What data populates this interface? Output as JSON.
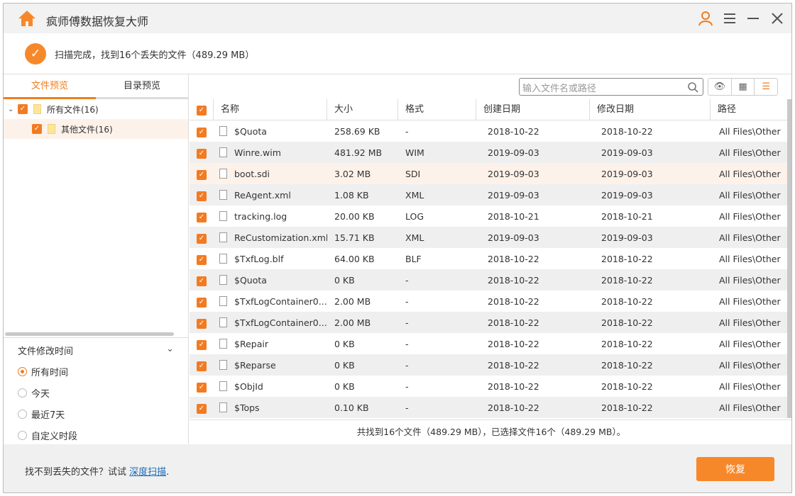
{
  "app": {
    "title": "疯师傅数据恢复大师"
  },
  "header": {
    "status": "扫描完成，找到16个丢失的文件（489.29 MB）"
  },
  "tabs": [
    {
      "label": "文件预览"
    },
    {
      "label": "目录预览"
    }
  ],
  "tree": [
    {
      "label": "所有文件(16)"
    },
    {
      "label": "其他文件(16)"
    }
  ],
  "filter": {
    "title": "文件修改时间",
    "options": [
      "所有时间",
      "今天",
      "最近7天",
      "自定义时段"
    ],
    "selected": "所有时间"
  },
  "search": {
    "placeholder": "输入文件名或路径"
  },
  "columns": [
    "名称",
    "大小",
    "格式",
    "创建日期",
    "修改日期",
    "路径"
  ],
  "rows": [
    [
      "$Quota",
      "258.69 KB",
      "-",
      "2018-10-22",
      "2018-10-22",
      "All Files\\Other"
    ],
    [
      "Winre.wim",
      "481.92 MB",
      "WIM",
      "2019-09-03",
      "2019-09-03",
      "All Files\\Other"
    ],
    [
      "boot.sdi",
      "3.02 MB",
      "SDI",
      "2019-09-03",
      "2019-09-03",
      "All Files\\Other"
    ],
    [
      "ReAgent.xml",
      "1.08 KB",
      "XML",
      "2019-09-03",
      "2019-09-03",
      "All Files\\Other"
    ],
    [
      "tracking.log",
      "20.00 KB",
      "LOG",
      "2018-10-21",
      "2018-10-21",
      "All Files\\Other"
    ],
    [
      "ReCustomization.xml",
      "15.71 KB",
      "XML",
      "2019-09-03",
      "2019-09-03",
      "All Files\\Other"
    ],
    [
      "$TxfLog.blf",
      "64.00 KB",
      "BLF",
      "2018-10-22",
      "2018-10-22",
      "All Files\\Other"
    ],
    [
      "$Quota",
      "0 KB",
      "-",
      "2018-10-22",
      "2018-10-22",
      "All Files\\Other"
    ],
    [
      "$TxfLogContainer0...",
      "2.00 MB",
      "-",
      "2018-10-22",
      "2018-10-22",
      "All Files\\Other"
    ],
    [
      "$TxfLogContainer0...",
      "2.00 MB",
      "-",
      "2018-10-22",
      "2018-10-22",
      "All Files\\Other"
    ],
    [
      "$Repair",
      "0 KB",
      "-",
      "2018-10-22",
      "2018-10-22",
      "All Files\\Other"
    ],
    [
      "$Reparse",
      "0 KB",
      "-",
      "2018-10-22",
      "2018-10-22",
      "All Files\\Other"
    ],
    [
      "$ObjId",
      "0 KB",
      "-",
      "2018-10-22",
      "2018-10-22",
      "All Files\\Other"
    ],
    [
      "$Tops",
      "0.10 KB",
      "-",
      "2018-10-22",
      "2018-10-22",
      "All Files\\Other"
    ]
  ],
  "summary": "共找到16个文件（489.29 MB），已选择文件16个（489.29 MB）。",
  "footer": {
    "text": "找不到丢失的文件？试试 ",
    "link": "深度扫描",
    "suffix": ".",
    "recover": "恢复"
  },
  "colors": {
    "accent": "#f7882a"
  }
}
